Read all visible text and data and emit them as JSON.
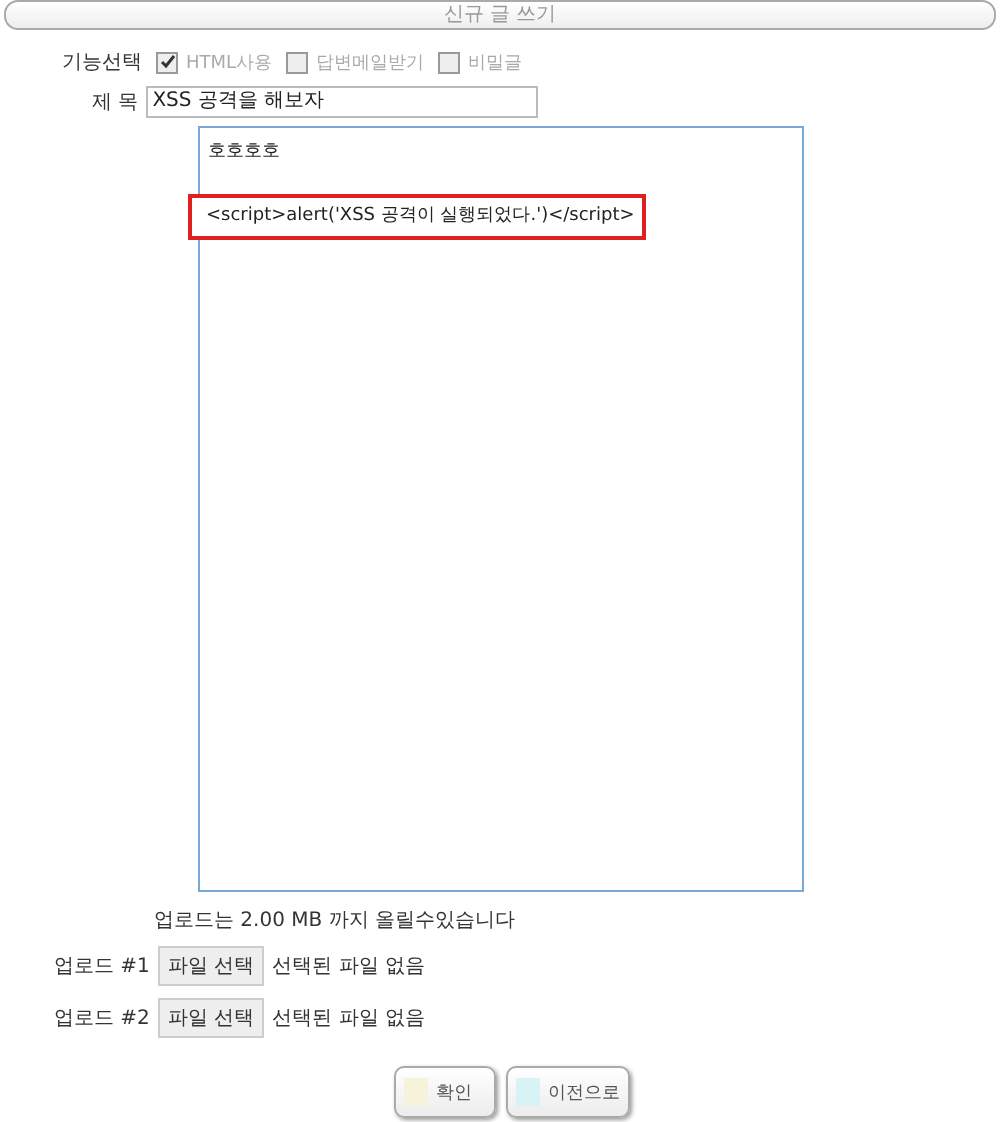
{
  "header": {
    "title": "신규 글 쓰기"
  },
  "options": {
    "label": "기능선택",
    "checkboxes": [
      {
        "label": "HTML사용",
        "checked": true
      },
      {
        "label": "답변메일받기",
        "checked": false
      },
      {
        "label": "비밀글",
        "checked": false
      }
    ]
  },
  "subject": {
    "label": "제 목",
    "value": "XSS 공격을 해보자"
  },
  "content": {
    "lines": [
      {
        "text": "호호호호",
        "highlighted": false
      },
      {
        "text": "<script>alert('XSS 공격이 실행되었다.')</script>",
        "highlighted": true
      }
    ]
  },
  "upload_note": "업로드는 2.00 MB 까지 올릴수있습니다",
  "uploads": [
    {
      "label": "업로드 #1",
      "button": "파일 선택",
      "status": "선택된 파일 없음"
    },
    {
      "label": "업로드 #2",
      "button": "파일 선택",
      "status": "선택된 파일 없음"
    }
  ],
  "buttons": [
    {
      "label": "확인",
      "color": "#f5f3dc"
    },
    {
      "label": "이전으로",
      "color": "#d8f3f5"
    }
  ]
}
